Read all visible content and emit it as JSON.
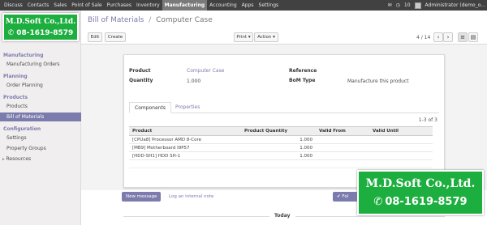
{
  "topbar": {
    "menu": [
      "Discuss",
      "Contacts",
      "Sales",
      "Point of Sale",
      "Purchases",
      "Inventory",
      "Manufacturing",
      "Accounting",
      "Apps",
      "Settings"
    ],
    "active_index": 6,
    "chat_icon": "comment-icon",
    "clock_icon": "clock-icon",
    "notification_count": "10",
    "user_name": "Administrator (demo_o..."
  },
  "logo": {
    "company": "M.D.Soft Co.,Ltd.",
    "phone": "08-1619-8579",
    "background": "#1cae3e"
  },
  "sidebar": {
    "sections": [
      {
        "title": "Manufacturing",
        "items": [
          "Manufacturing Orders"
        ]
      },
      {
        "title": "Planning",
        "items": [
          "Order Planning"
        ]
      },
      {
        "title": "Products",
        "items": [
          "Products",
          "Bill of Materials"
        ]
      },
      {
        "title": "Configuration",
        "items": [
          "Settings",
          "Property Groups",
          "Resources"
        ]
      }
    ],
    "active_item": "Bill of Materials",
    "accent": "#7c7bad"
  },
  "breadcrumb": {
    "parent": "Bill of Materials",
    "separator": "/",
    "current": "Computer Case"
  },
  "toolbar": {
    "edit_label": "Edit",
    "create_label": "Create",
    "print_label": "Print",
    "action_label": "Action",
    "pager": "4 / 14"
  },
  "form": {
    "product_label": "Product",
    "product_value": "Computer Case",
    "quantity_label": "Quantity",
    "quantity_value": "1.000",
    "reference_label": "Reference",
    "reference_value": "",
    "bom_type_label": "BoM Type",
    "bom_type_value": "Manufacture this product"
  },
  "tabs": [
    "Components",
    "Properties"
  ],
  "components": {
    "count": "1-3 of 3",
    "columns": [
      "Product",
      "Product Quantity",
      "Valid From",
      "Valid Until"
    ],
    "rows": [
      {
        "product": "[CPUa8] Processor AMD 8-Core",
        "qty": "1.000",
        "from": "",
        "until": ""
      },
      {
        "product": "[MB9] Motherboard I9P57",
        "qty": "1.000",
        "from": "",
        "until": ""
      },
      {
        "product": "[HDD-SH1] HDD SH-1",
        "qty": "1.000",
        "from": "",
        "until": ""
      }
    ]
  },
  "chatter": {
    "new_message_label": "New message",
    "log_note_label": "Log an internal note",
    "follow_label": "Fol",
    "today_label": "Today"
  }
}
